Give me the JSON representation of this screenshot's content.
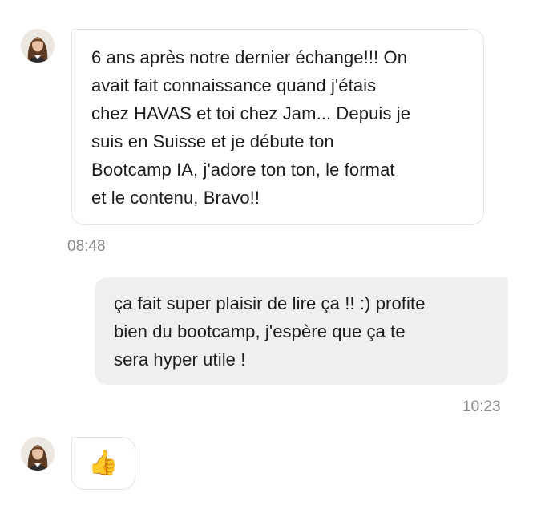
{
  "messages": [
    {
      "direction": "incoming",
      "sender_avatar": "avatar-woman-dark-hair",
      "text": "6 ans après notre dernier échange!!! On\navait fait connaissance quand j'étais\nchez HAVAS et toi chez Jam... Depuis je\nsuis en Suisse et je débute ton\nBootcamp IA, j'adore ton ton, le format\net le contenu, Bravo!!",
      "time": "08:48"
    },
    {
      "direction": "outgoing",
      "text": "ça fait super plaisir de lire ça !! :) profite\nbien du bootcamp, j'espère que ça te\nsera hyper utile !",
      "time": "10:23"
    },
    {
      "direction": "incoming",
      "sender_avatar": "avatar-woman-dark-hair",
      "text": "👍",
      "icon": "thumbs-up-icon"
    }
  ],
  "colors": {
    "incoming_bg": "#ffffff",
    "incoming_border": "#e4e4e6",
    "outgoing_bg": "#efeff1",
    "timestamp": "#8a8a8e"
  }
}
